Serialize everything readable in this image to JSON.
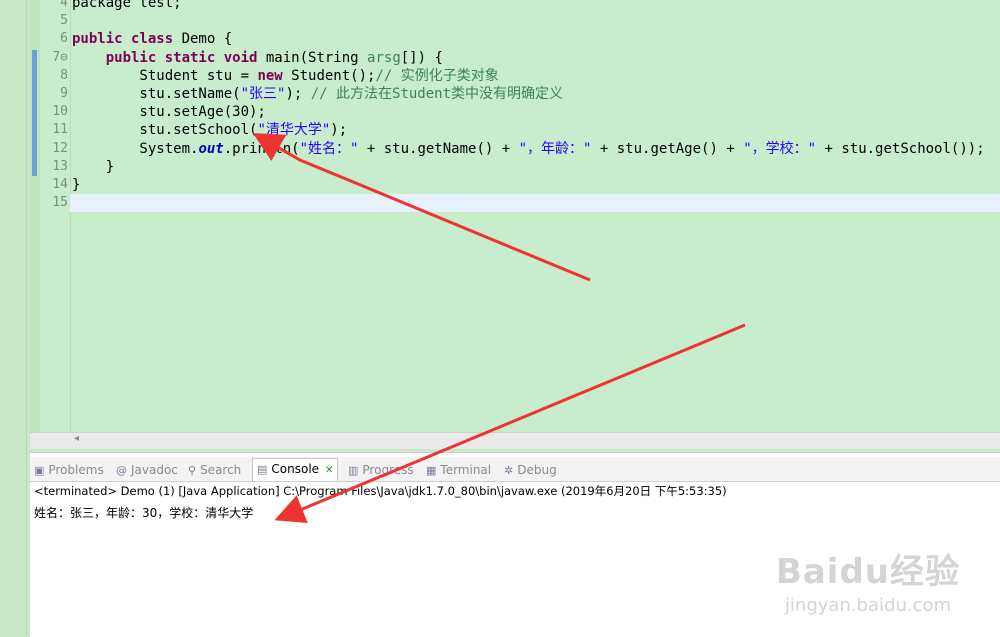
{
  "editor": {
    "lines": [
      {
        "num": "4",
        "parts": [
          {
            "t": "package test;",
            "c": ""
          }
        ]
      },
      {
        "num": "5",
        "parts": []
      },
      {
        "num": "6",
        "parts": [
          {
            "t": "public class ",
            "c": "kw"
          },
          {
            "t": "Demo {",
            "c": ""
          }
        ]
      },
      {
        "num": "7⊖",
        "parts": [
          {
            "t": "    ",
            "c": ""
          },
          {
            "t": "public static void ",
            "c": "kw"
          },
          {
            "t": "main(String ",
            "c": ""
          },
          {
            "t": "arsg",
            "c": "cmt"
          },
          {
            "t": "[]) {",
            "c": ""
          }
        ]
      },
      {
        "num": "8",
        "parts": [
          {
            "t": "        Student stu = ",
            "c": ""
          },
          {
            "t": "new ",
            "c": "kw"
          },
          {
            "t": "Student();",
            "c": ""
          },
          {
            "t": "// 实例化子类对象",
            "c": "cmt"
          }
        ]
      },
      {
        "num": "9",
        "parts": [
          {
            "t": "        stu.setName(",
            "c": ""
          },
          {
            "t": "\"张三\"",
            "c": "str"
          },
          {
            "t": "); ",
            "c": ""
          },
          {
            "t": "// 此方法在Student类中没有明确定义",
            "c": "cmt"
          }
        ]
      },
      {
        "num": "10",
        "parts": [
          {
            "t": "        stu.setAge(30);",
            "c": ""
          }
        ]
      },
      {
        "num": "11",
        "parts": [
          {
            "t": "        stu.setSchool(",
            "c": ""
          },
          {
            "t": "\"清华大学\"",
            "c": "str"
          },
          {
            "t": ");",
            "c": ""
          }
        ]
      },
      {
        "num": "12",
        "parts": [
          {
            "t": "        System.",
            "c": ""
          },
          {
            "t": "out",
            "c": "fld"
          },
          {
            "t": ".println(",
            "c": ""
          },
          {
            "t": "\"姓名：\"",
            "c": "str"
          },
          {
            "t": " + stu.getName() + ",
            "c": ""
          },
          {
            "t": "\"，年龄：\"",
            "c": "str"
          },
          {
            "t": " + stu.getAge() + ",
            "c": ""
          },
          {
            "t": "\"，学校：\"",
            "c": "str"
          },
          {
            "t": " + stu.getSchool());",
            "c": ""
          }
        ]
      },
      {
        "num": "13",
        "parts": [
          {
            "t": "    }",
            "c": ""
          }
        ]
      },
      {
        "num": "14",
        "parts": [
          {
            "t": "}",
            "c": ""
          }
        ]
      },
      {
        "num": "15",
        "parts": []
      }
    ]
  },
  "scroll": {
    "left_arrow": "◂"
  },
  "console": {
    "tabs": [
      {
        "name": "problems",
        "icon": "▣",
        "icon_name": "problems-icon",
        "label": "Problems",
        "active": false
      },
      {
        "name": "javadoc",
        "icon": "@",
        "icon_name": "javadoc-icon",
        "label": "Javadoc",
        "active": false
      },
      {
        "name": "search",
        "icon": "⚲",
        "icon_name": "search-icon",
        "label": "Search",
        "active": false
      },
      {
        "name": "console",
        "icon": "▤",
        "icon_name": "console-icon",
        "label": "Console",
        "close": "✕",
        "active": true
      },
      {
        "name": "progress",
        "icon": "▥",
        "icon_name": "progress-icon",
        "label": "Progress",
        "active": false
      },
      {
        "name": "terminal",
        "icon": "▦",
        "icon_name": "terminal-icon",
        "label": "Terminal",
        "active": false
      },
      {
        "name": "debug",
        "icon": "✲",
        "icon_name": "debug-icon",
        "label": "Debug",
        "active": false
      }
    ],
    "status": "<terminated> Demo (1) [Java Application] C:\\Program Files\\Java\\jdk1.7.0_80\\bin\\javaw.exe (2019年6月20日 下午5:53:35)",
    "output": "姓名：张三，年龄：30，学校：清华大学"
  },
  "watermark": {
    "brand": "Baidu经验",
    "url": "jingyan.baidu.com"
  },
  "colors": {
    "arrow": "#ee3333",
    "keyword": "#7f0055",
    "string": "#2a00ff",
    "comment": "#3f7f5f",
    "editor_bg": "#c7edcc"
  }
}
